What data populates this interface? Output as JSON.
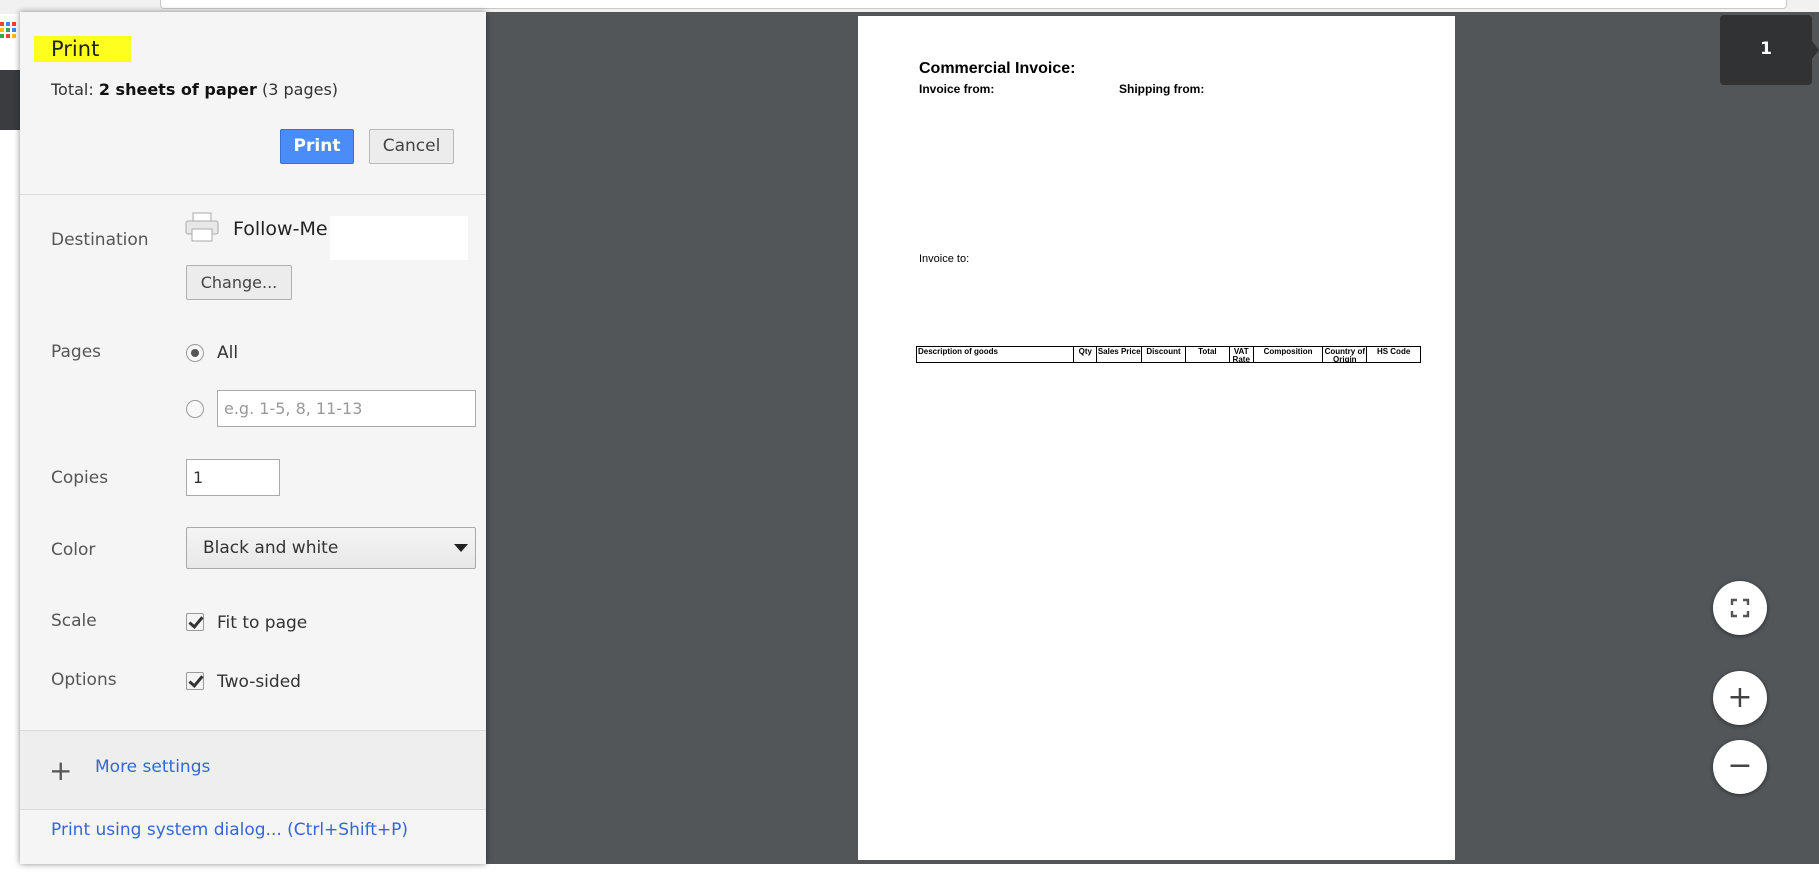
{
  "dialog": {
    "title": "Print",
    "total_prefix": "Total: ",
    "total_sheets": "2 sheets of paper",
    "total_pages": "(3 pages)",
    "print_button": "Print",
    "cancel_button": "Cancel",
    "destination": {
      "label": "Destination",
      "name": "Follow-Me",
      "change_button": "Change..."
    },
    "pages": {
      "label": "Pages",
      "all_option": "All",
      "custom_placeholder": "e.g. 1-5, 8, 11-13",
      "selected": "All"
    },
    "copies": {
      "label": "Copies",
      "value": "1"
    },
    "color": {
      "label": "Color",
      "value": "Black and white"
    },
    "scale": {
      "label": "Scale",
      "option": "Fit to page",
      "checked": true
    },
    "options": {
      "label": "Options",
      "option": "Two-sided",
      "checked": true
    },
    "more_settings": "More settings",
    "system_dialog_link": "Print using system dialog... (Ctrl+Shift+P)"
  },
  "preview": {
    "page_number": "1",
    "document": {
      "title": "Commercial Invoice:",
      "invoice_from": "Invoice from:",
      "shipping_from": "Shipping from:",
      "invoice_to": "Invoice to:",
      "table_headers": [
        "Description of goods",
        "Qty",
        "Sales Price",
        "Discount",
        "Total",
        "VAT Rate",
        "Composition",
        "Country of Origin",
        "HS Code"
      ]
    },
    "controls": [
      "fit-to-page-icon",
      "zoom-in-icon",
      "zoom-out-icon"
    ]
  },
  "colors": {
    "accent": "#4b8df8",
    "highlight": "#ffff1f",
    "link": "#3367d6",
    "preview_bg": "#525659"
  }
}
